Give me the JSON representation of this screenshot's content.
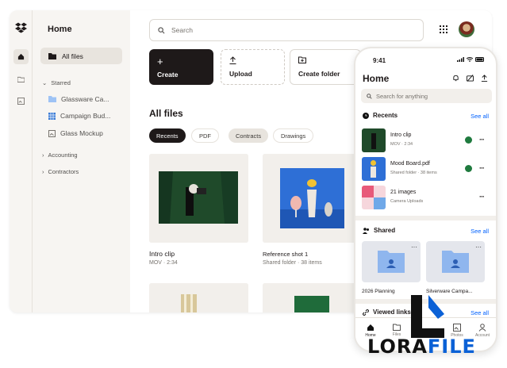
{
  "sidebar": {
    "title": "Home",
    "all_files": "All files",
    "starred_label": "Starred",
    "starred": [
      {
        "label": "Glassware Ca..."
      },
      {
        "label": "Campaign Bud..."
      },
      {
        "label": "Glass Mockup"
      }
    ],
    "accounting": "Accounting",
    "contractors": "Contractors"
  },
  "search": {
    "placeholder": "Search"
  },
  "actions": {
    "create": "Create",
    "upload": "Upload",
    "create_folder": "Create folder"
  },
  "files": {
    "heading": "All files",
    "filters": [
      "Recents",
      "PDF",
      "Contracts",
      "Drawings"
    ],
    "items": [
      {
        "name": "Intro clip",
        "meta": "MOV · 2:34"
      },
      {
        "name": "Reference shot 1",
        "meta": "Shared folder · 38 items"
      }
    ]
  },
  "phone": {
    "time": "9:41",
    "title": "Home",
    "search_placeholder": "Search for anything",
    "recents_label": "Recents",
    "see_all": "See all",
    "recents": [
      {
        "name": "Intro clip",
        "meta": "MOV · 2:34"
      },
      {
        "name": "Mood Board.pdf",
        "meta": "Shared folder · 38 items"
      },
      {
        "name": "21 images",
        "meta": "Camera Uploads"
      }
    ],
    "shared_label": "Shared",
    "shared": [
      {
        "name": "2026 Planning"
      },
      {
        "name": "Silverware Campa..."
      }
    ],
    "viewed_label": "Viewed links",
    "tabs": [
      "Home",
      "Files",
      "Photos",
      "Account"
    ]
  },
  "watermark": {
    "part1": "LORA",
    "part2": "FILE"
  },
  "colors": {
    "accent": "#0061fe",
    "dark": "#1e1919",
    "success": "#1f7a3e"
  }
}
